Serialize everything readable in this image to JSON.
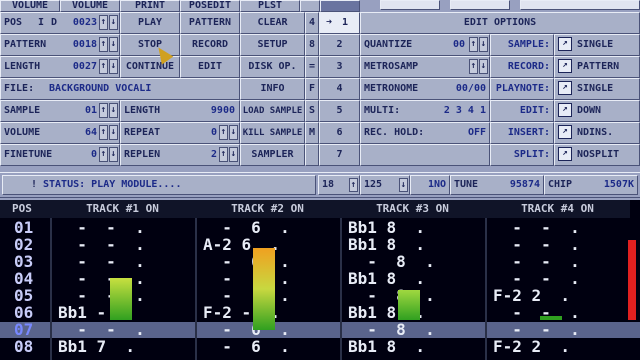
{
  "topbar": {
    "left": [
      "VOLUME",
      "PRINT",
      "POSEDIT",
      "PLST"
    ],
    "right_tabs": [
      "",
      ""
    ]
  },
  "controls": {
    "pos": {
      "label": "POS",
      "mode": "I",
      "mode2": "D",
      "value": "0023"
    },
    "pattern": {
      "label": "PATTERN",
      "value": "0018"
    },
    "length": {
      "label": "LENGTH",
      "value": "0027"
    },
    "file": {
      "label": "FILE:",
      "value": "BACKGROUND VOCALI"
    },
    "sample": {
      "label": "SAMPLE",
      "value": "01"
    },
    "volume": {
      "label": "VOLUME",
      "value": "64"
    },
    "finetune": {
      "label": "FINETUNE",
      "value": "0"
    },
    "sample_length": {
      "label": "LENGTH",
      "value": "9900"
    },
    "repeat": {
      "label": "REPEAT",
      "value": "0"
    },
    "replen": {
      "label": "REPLEN",
      "value": "2"
    },
    "arrow_up": "↑",
    "arrow_down": "↓"
  },
  "buttons": {
    "play": "PLAY",
    "pattern": "PATTERN",
    "clear": "CLEAR",
    "stop": "STOP",
    "record": "RECORD",
    "setup": "SETUP",
    "continue": "CONTINUE",
    "edit": "EDIT",
    "disk_op": "DISK OP.",
    "info": "INFO",
    "load_sample": "LOAD SAMPLE",
    "kill_sample": "KILL SAMPLE",
    "sampler": "SAMPLER"
  },
  "tracks": {
    "keys": [
      "4",
      "8",
      "=",
      "F",
      "S",
      "M",
      ""
    ],
    "nums": [
      "1",
      "2",
      "3",
      "4",
      "5",
      "6",
      "7"
    ]
  },
  "edit_options": {
    "title": "EDIT OPTIONS",
    "quantize": {
      "label": "QUANTIZE",
      "value": "00"
    },
    "metrosamp": {
      "label": "METROSAMP"
    },
    "metronome": {
      "label": "METRONOME",
      "value": "00/00"
    },
    "multi": {
      "label": "MULTI:",
      "value": "2 3 4 1"
    },
    "rec_hold": {
      "label": "REC. HOLD:",
      "value": "OFF"
    },
    "right": [
      {
        "label": "SAMPLE:",
        "value": "SINGLE"
      },
      {
        "label": "RECORD:",
        "value": "PATTERN"
      },
      {
        "label": "PLAYNOTE:",
        "value": "SINGLE"
      },
      {
        "label": "EDIT:",
        "value": "DOWN"
      },
      {
        "label": "INSERT:",
        "value": "NDINS."
      },
      {
        "label": "SPLIT:",
        "value": "NOSPLIT"
      }
    ]
  },
  "status": {
    "prefix": "!",
    "text": "STATUS:  PLAY MODULE....",
    "speed": "18",
    "bpm": "125",
    "mode": "1NO",
    "tune_label": "TUNE",
    "tune_value": "95874",
    "chip_label": "CHIP",
    "chip_value": "1507K"
  },
  "pattern_view": {
    "pos_label": "POS",
    "tracks": [
      "TRACK #1 ON",
      "TRACK #2 ON",
      "TRACK #3 ON",
      "TRACK #4 ON"
    ],
    "rows": [
      {
        "n": "01",
        "c": [
          "  -  -  .",
          "  -  6  .",
          "Bb1 8  .",
          "  -  -  ."
        ]
      },
      {
        "n": "02",
        "c": [
          "  -  -  .",
          "A-2 6  .",
          "Bb1 8  .",
          "  -  -  ."
        ]
      },
      {
        "n": "03",
        "c": [
          "  -  -  .",
          "  -  6  .",
          "  -  8  .",
          "  -  -  ."
        ]
      },
      {
        "n": "04",
        "c": [
          "  -  -  .",
          "  -  -  .",
          "Bb1 8  .",
          "  -  -  ."
        ]
      },
      {
        "n": "05",
        "c": [
          "  -  -  .",
          "  -  -  .",
          "  -  8  .",
          "F-2 2  ."
        ]
      },
      {
        "n": "06",
        "c": [
          "Bb1 -  .",
          "F-2 -  .",
          "Bb1 8  .",
          "  -  -  ."
        ]
      },
      {
        "n": "07",
        "c": [
          "  -  -  .",
          "  -  6  .",
          "  -  8  .",
          "  -  -  ."
        ]
      },
      {
        "n": "08",
        "c": [
          "Bb1 7  .",
          "  -  6  .",
          "Bb1 8  .",
          "F-2 2  ."
        ]
      }
    ],
    "current_row": 6
  }
}
